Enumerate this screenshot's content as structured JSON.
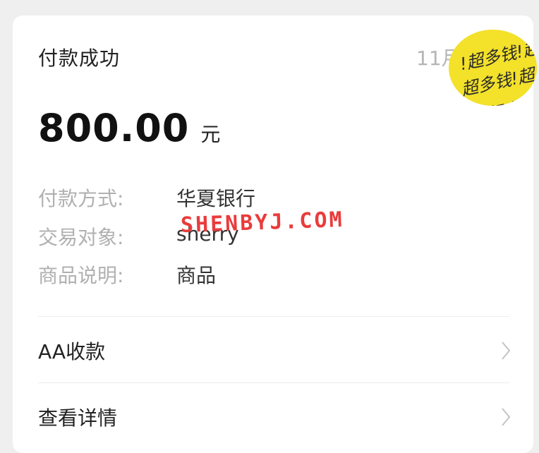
{
  "header": {
    "title": "付款成功",
    "date": "11月"
  },
  "sticker": {
    "lines": [
      "!超多钱!超多",
      "超多钱!超多",
      "超多钱"
    ]
  },
  "amount": {
    "value": "800.00",
    "unit": "元"
  },
  "details": [
    {
      "label": "付款方式:",
      "value": "华夏银行"
    },
    {
      "label": "交易对象:",
      "value": "sherry"
    },
    {
      "label": "商品说明:",
      "value": "商品"
    }
  ],
  "watermark": "SHENBYJ.COM",
  "actions": [
    {
      "label": "AA收款"
    },
    {
      "label": "查看详情"
    }
  ],
  "icons": {
    "chevron": "chevron-right-icon"
  }
}
